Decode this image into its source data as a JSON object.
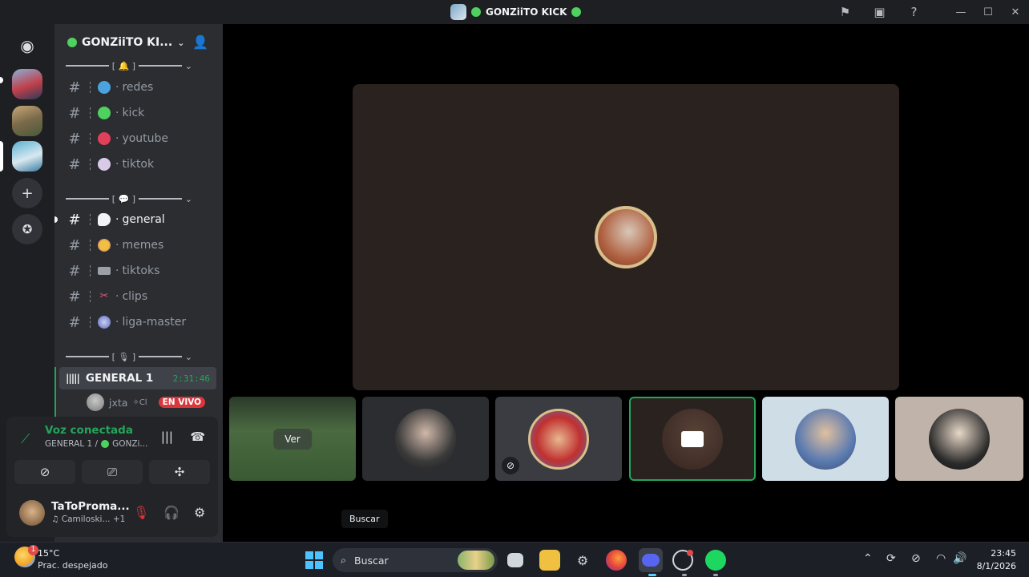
{
  "window": {
    "title": "GONZiiTO KICK",
    "title_icons": [
      "flag-icon",
      "inbox-icon",
      "help-icon"
    ],
    "controls": [
      "minimize-icon",
      "maximize-icon",
      "close-icon"
    ]
  },
  "server": {
    "name": "GONZiiTO KI...",
    "categories": [
      {
        "label": "[ 🔔 ]"
      },
      {
        "label": "[ 💬 ]"
      },
      {
        "label": "[ 🎙 ]"
      }
    ],
    "channels_social": [
      {
        "name": "redes",
        "icon": "globe-icon",
        "color": "#4aa3df"
      },
      {
        "name": "kick",
        "icon": "green-circle-icon",
        "color": "#4ed15e"
      },
      {
        "name": "youtube",
        "icon": "red-circle-icon",
        "color": "#e0405a"
      },
      {
        "name": "tiktok",
        "icon": "white-circle-icon",
        "color": "#d9cbe8"
      }
    ],
    "channels_chat": [
      {
        "name": "general",
        "icon": "speech-bubble-icon",
        "color": "#f2f3f5"
      },
      {
        "name": "memes",
        "icon": "emoji-icon",
        "color": "#f0c040"
      },
      {
        "name": "tiktoks",
        "icon": "camera-icon",
        "color": "#9aa0a6"
      },
      {
        "name": "clips",
        "icon": "scissors-icon",
        "color": "#e05a7a"
      },
      {
        "name": "liga-master",
        "icon": "ball-icon",
        "color": "#7a8ad0"
      }
    ],
    "voice_channel": {
      "name": "GENERAL 1",
      "elapsed": "2:31:46",
      "user": "jxta",
      "user_suffix": "✧Cl",
      "live_badge": "EN VIVO"
    }
  },
  "voice_panel": {
    "status": "Voz conectada",
    "location": "GENERAL 1 / ",
    "location_server": "GONZi...",
    "user": {
      "name": "TaToProma...",
      "activity": "♫ Camiloski...",
      "extra": "+1"
    }
  },
  "stage": {
    "tiles": [
      {
        "kind": "stream",
        "label": "Ver",
        "bg": "#3f5a3a"
      },
      {
        "kind": "avatar",
        "bg": "#2b2d31"
      },
      {
        "kind": "avatar",
        "bg": "#3a3c42",
        "muted": true
      },
      {
        "kind": "camera",
        "bg": "#2a221f",
        "speaking": true
      },
      {
        "kind": "avatar",
        "bg": "#cfdde6"
      },
      {
        "kind": "avatar",
        "bg": "#bfb3aa"
      }
    ]
  },
  "tooltip": "Buscar",
  "taskbar": {
    "weather_temp": "15°C",
    "weather_desc": "Prac. despejado",
    "weather_badge": "1",
    "search_placeholder": "Buscar",
    "time": "23:45",
    "date": "8/1/2026"
  }
}
